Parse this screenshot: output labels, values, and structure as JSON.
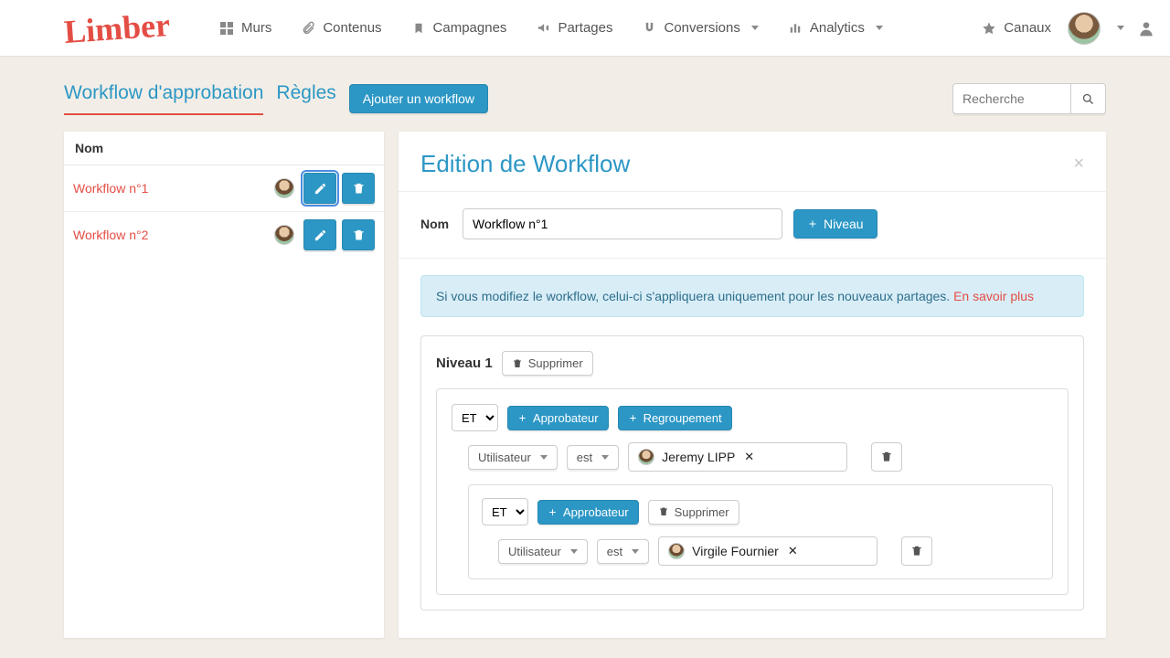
{
  "brand": "Limber",
  "nav": {
    "murs": "Murs",
    "contenus": "Contenus",
    "campagnes": "Campagnes",
    "partages": "Partages",
    "conversions": "Conversions",
    "analytics": "Analytics",
    "canaux": "Canaux"
  },
  "tabs": {
    "workflow": "Workflow d'approbation",
    "rules": "Règles"
  },
  "add_workflow": "Ajouter un workflow",
  "search_placeholder": "Recherche",
  "list_header": "Nom",
  "workflows": [
    {
      "name": "Workflow n°1"
    },
    {
      "name": "Workflow n°2"
    }
  ],
  "editor": {
    "title": "Edition de Workflow",
    "name_label": "Nom",
    "name_value": "Workflow n°1",
    "add_level": "Niveau",
    "alert_text": "Si vous modifiez le workflow, celui-ci s'appliquera uniquement pour les nouveaux partages.",
    "alert_link": "En savoir plus"
  },
  "level": {
    "title": "Niveau 1",
    "delete": "Supprimer",
    "logic_a": "ET",
    "logic_b": "ET",
    "approver": "Approbateur",
    "grouping": "Regroupement",
    "delete_sub": "Supprimer",
    "filter_attr_a": "Utilisateur",
    "filter_op_a": "est",
    "filter_attr_b": "Utilisateur",
    "filter_op_b": "est",
    "user_a": "Jeremy LIPP",
    "user_b": "Virgile Fournier"
  }
}
